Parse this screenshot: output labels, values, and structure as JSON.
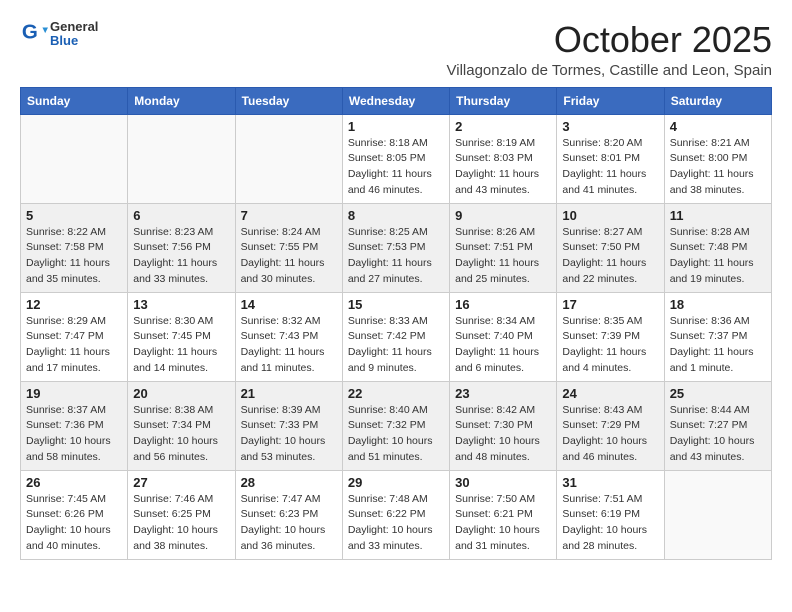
{
  "header": {
    "logo_general": "General",
    "logo_blue": "Blue",
    "month": "October 2025",
    "location": "Villagonzalo de Tormes, Castille and Leon, Spain"
  },
  "weekdays": [
    "Sunday",
    "Monday",
    "Tuesday",
    "Wednesday",
    "Thursday",
    "Friday",
    "Saturday"
  ],
  "weeks": [
    [
      {
        "day": "",
        "info": ""
      },
      {
        "day": "",
        "info": ""
      },
      {
        "day": "",
        "info": ""
      },
      {
        "day": "1",
        "info": "Sunrise: 8:18 AM\nSunset: 8:05 PM\nDaylight: 11 hours and 46 minutes."
      },
      {
        "day": "2",
        "info": "Sunrise: 8:19 AM\nSunset: 8:03 PM\nDaylight: 11 hours and 43 minutes."
      },
      {
        "day": "3",
        "info": "Sunrise: 8:20 AM\nSunset: 8:01 PM\nDaylight: 11 hours and 41 minutes."
      },
      {
        "day": "4",
        "info": "Sunrise: 8:21 AM\nSunset: 8:00 PM\nDaylight: 11 hours and 38 minutes."
      }
    ],
    [
      {
        "day": "5",
        "info": "Sunrise: 8:22 AM\nSunset: 7:58 PM\nDaylight: 11 hours and 35 minutes."
      },
      {
        "day": "6",
        "info": "Sunrise: 8:23 AM\nSunset: 7:56 PM\nDaylight: 11 hours and 33 minutes."
      },
      {
        "day": "7",
        "info": "Sunrise: 8:24 AM\nSunset: 7:55 PM\nDaylight: 11 hours and 30 minutes."
      },
      {
        "day": "8",
        "info": "Sunrise: 8:25 AM\nSunset: 7:53 PM\nDaylight: 11 hours and 27 minutes."
      },
      {
        "day": "9",
        "info": "Sunrise: 8:26 AM\nSunset: 7:51 PM\nDaylight: 11 hours and 25 minutes."
      },
      {
        "day": "10",
        "info": "Sunrise: 8:27 AM\nSunset: 7:50 PM\nDaylight: 11 hours and 22 minutes."
      },
      {
        "day": "11",
        "info": "Sunrise: 8:28 AM\nSunset: 7:48 PM\nDaylight: 11 hours and 19 minutes."
      }
    ],
    [
      {
        "day": "12",
        "info": "Sunrise: 8:29 AM\nSunset: 7:47 PM\nDaylight: 11 hours and 17 minutes."
      },
      {
        "day": "13",
        "info": "Sunrise: 8:30 AM\nSunset: 7:45 PM\nDaylight: 11 hours and 14 minutes."
      },
      {
        "day": "14",
        "info": "Sunrise: 8:32 AM\nSunset: 7:43 PM\nDaylight: 11 hours and 11 minutes."
      },
      {
        "day": "15",
        "info": "Sunrise: 8:33 AM\nSunset: 7:42 PM\nDaylight: 11 hours and 9 minutes."
      },
      {
        "day": "16",
        "info": "Sunrise: 8:34 AM\nSunset: 7:40 PM\nDaylight: 11 hours and 6 minutes."
      },
      {
        "day": "17",
        "info": "Sunrise: 8:35 AM\nSunset: 7:39 PM\nDaylight: 11 hours and 4 minutes."
      },
      {
        "day": "18",
        "info": "Sunrise: 8:36 AM\nSunset: 7:37 PM\nDaylight: 11 hours and 1 minute."
      }
    ],
    [
      {
        "day": "19",
        "info": "Sunrise: 8:37 AM\nSunset: 7:36 PM\nDaylight: 10 hours and 58 minutes."
      },
      {
        "day": "20",
        "info": "Sunrise: 8:38 AM\nSunset: 7:34 PM\nDaylight: 10 hours and 56 minutes."
      },
      {
        "day": "21",
        "info": "Sunrise: 8:39 AM\nSunset: 7:33 PM\nDaylight: 10 hours and 53 minutes."
      },
      {
        "day": "22",
        "info": "Sunrise: 8:40 AM\nSunset: 7:32 PM\nDaylight: 10 hours and 51 minutes."
      },
      {
        "day": "23",
        "info": "Sunrise: 8:42 AM\nSunset: 7:30 PM\nDaylight: 10 hours and 48 minutes."
      },
      {
        "day": "24",
        "info": "Sunrise: 8:43 AM\nSunset: 7:29 PM\nDaylight: 10 hours and 46 minutes."
      },
      {
        "day": "25",
        "info": "Sunrise: 8:44 AM\nSunset: 7:27 PM\nDaylight: 10 hours and 43 minutes."
      }
    ],
    [
      {
        "day": "26",
        "info": "Sunrise: 7:45 AM\nSunset: 6:26 PM\nDaylight: 10 hours and 40 minutes."
      },
      {
        "day": "27",
        "info": "Sunrise: 7:46 AM\nSunset: 6:25 PM\nDaylight: 10 hours and 38 minutes."
      },
      {
        "day": "28",
        "info": "Sunrise: 7:47 AM\nSunset: 6:23 PM\nDaylight: 10 hours and 36 minutes."
      },
      {
        "day": "29",
        "info": "Sunrise: 7:48 AM\nSunset: 6:22 PM\nDaylight: 10 hours and 33 minutes."
      },
      {
        "day": "30",
        "info": "Sunrise: 7:50 AM\nSunset: 6:21 PM\nDaylight: 10 hours and 31 minutes."
      },
      {
        "day": "31",
        "info": "Sunrise: 7:51 AM\nSunset: 6:19 PM\nDaylight: 10 hours and 28 minutes."
      },
      {
        "day": "",
        "info": ""
      }
    ]
  ]
}
